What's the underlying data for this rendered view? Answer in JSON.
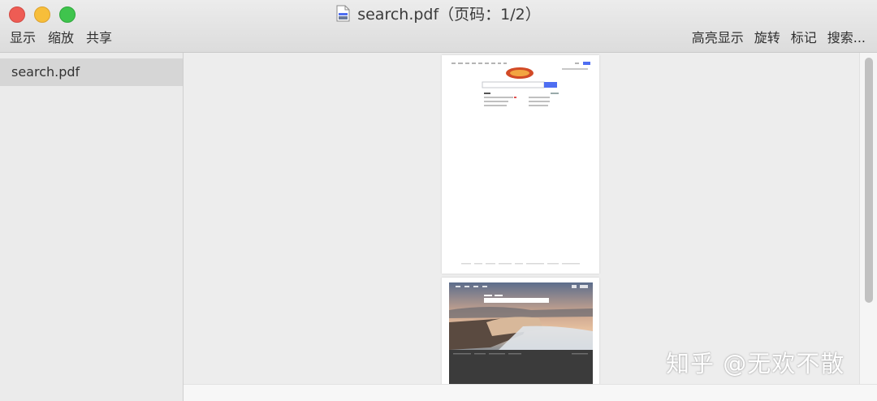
{
  "window": {
    "title": "search.pdf（页码：1/2）",
    "title_icon": "pdf-document-icon"
  },
  "toolbar": {
    "left": [
      "显示",
      "缩放",
      "共享"
    ],
    "right": [
      "高亮显示",
      "旋转",
      "标记",
      "搜索..."
    ]
  },
  "sidebar": {
    "items": [
      {
        "label": "search.pdf",
        "selected": true
      }
    ]
  },
  "document": {
    "pages": [
      {
        "label": "page-1-search-homepage"
      },
      {
        "label": "page-2-landscape-search"
      }
    ]
  },
  "watermark": "知乎 @无欢不散",
  "colors": {
    "close": "#ee5c54",
    "minimize": "#f7be3a",
    "maximize": "#3fc44d",
    "accent": "#4e6ef2"
  }
}
